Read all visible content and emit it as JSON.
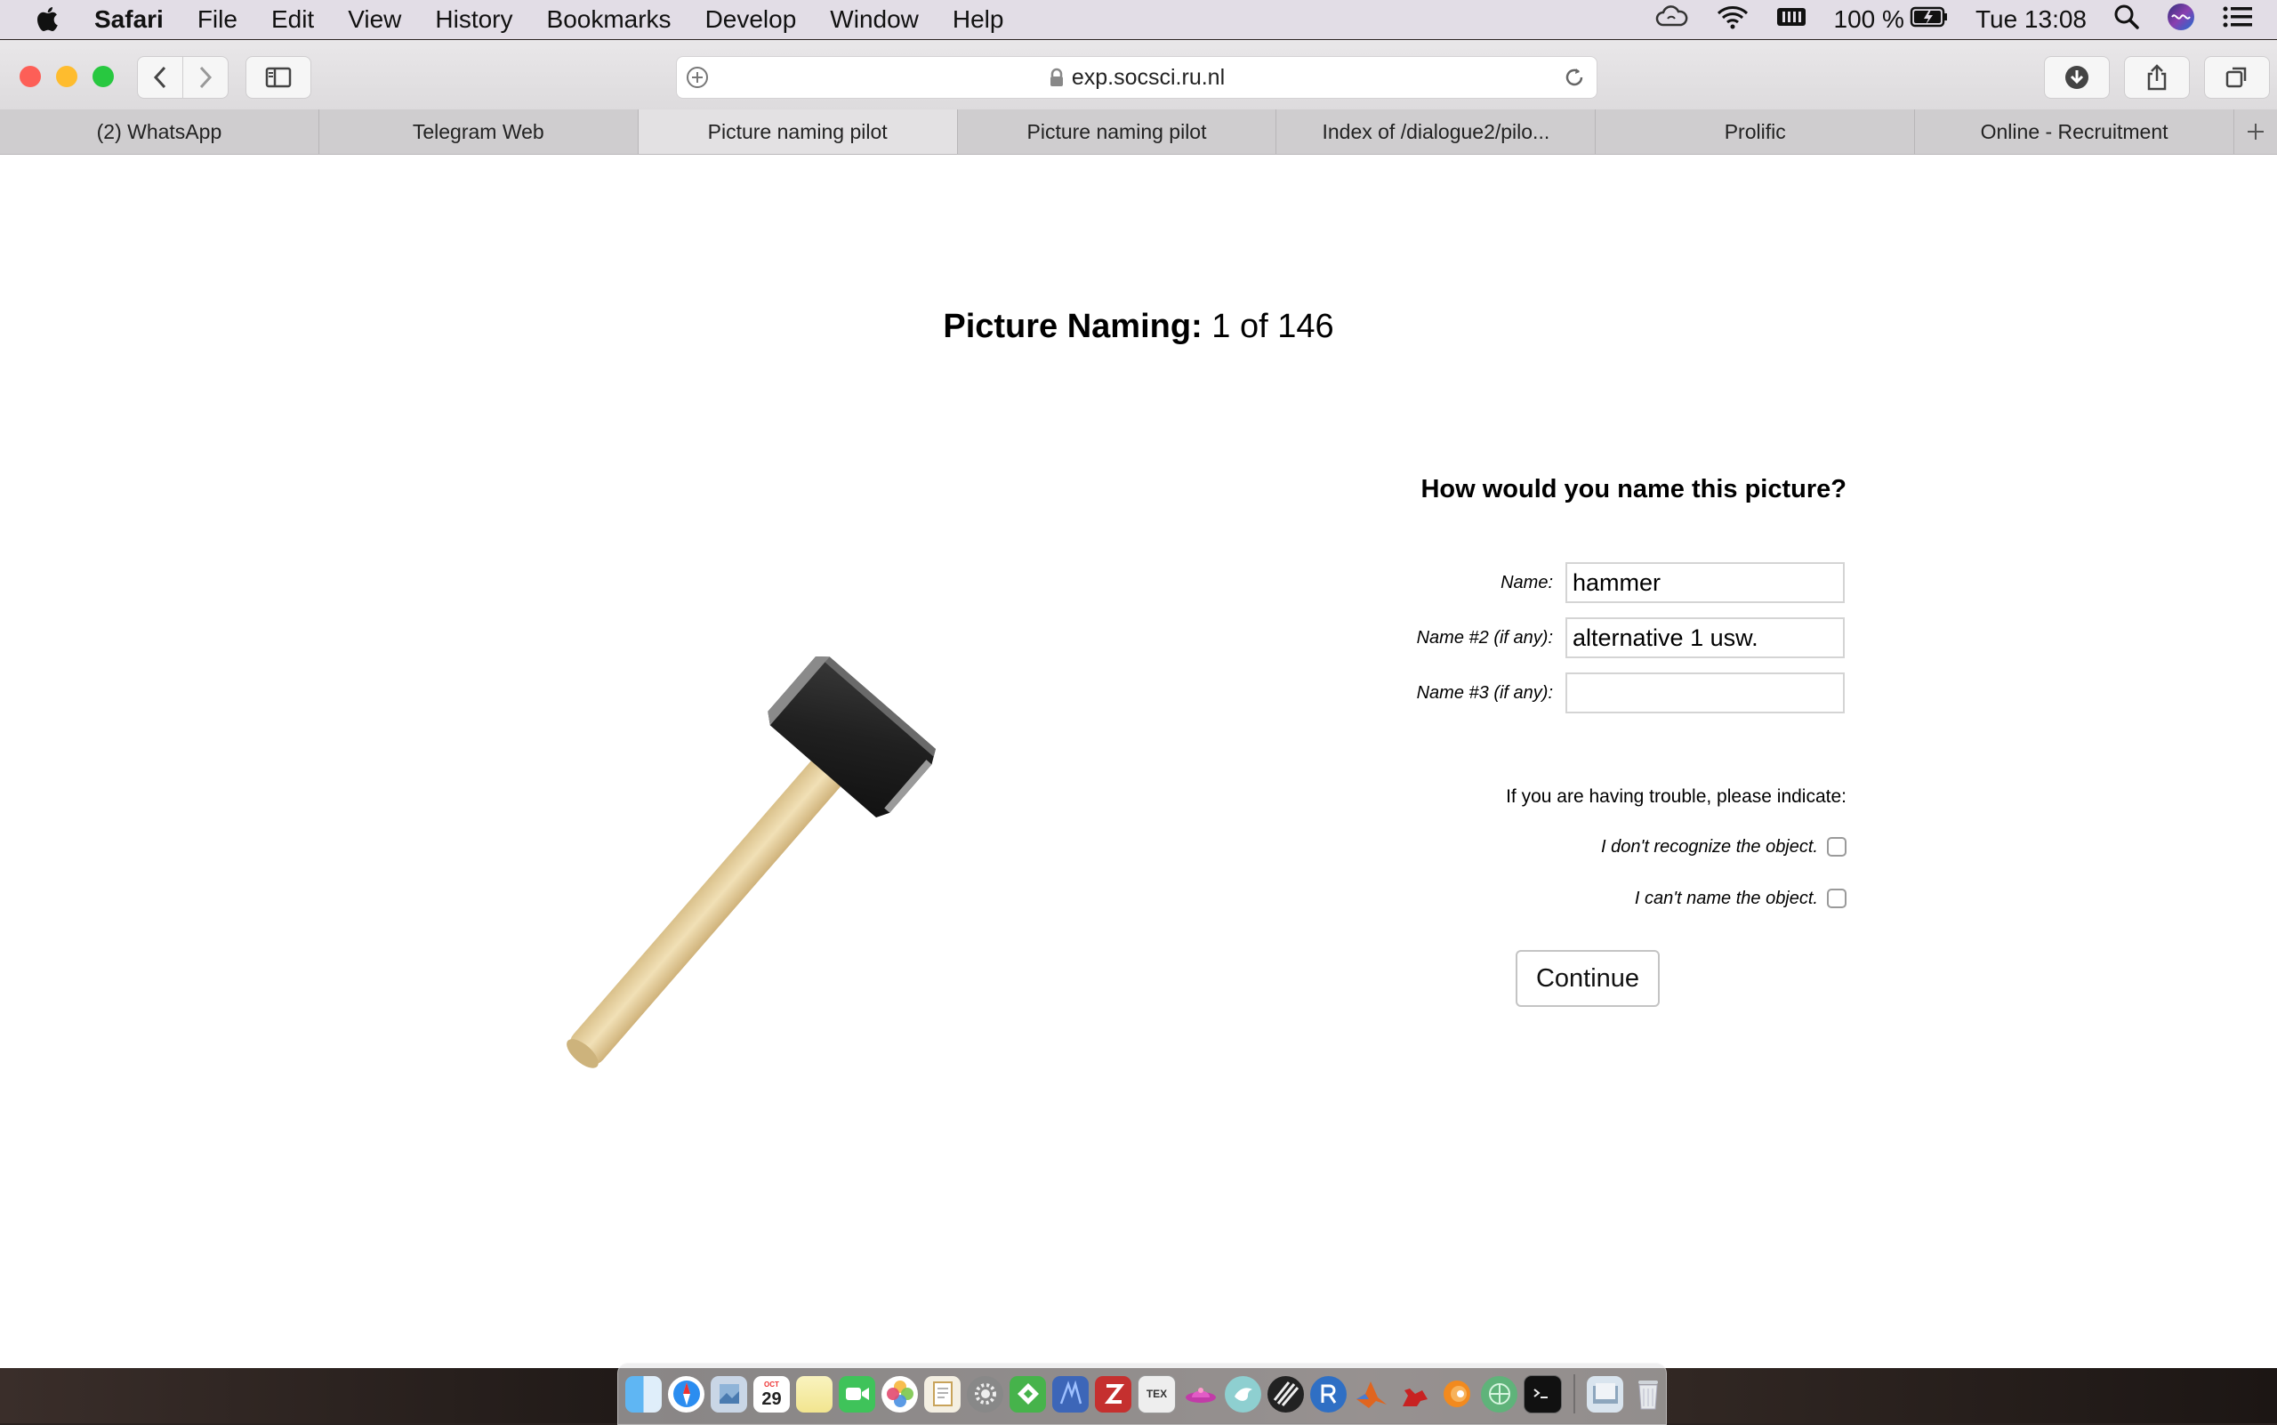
{
  "menubar": {
    "app": "Safari",
    "items": [
      "File",
      "Edit",
      "View",
      "History",
      "Bookmarks",
      "Develop",
      "Window",
      "Help"
    ],
    "battery": "100 %",
    "clock": "Tue 13:08"
  },
  "browser": {
    "url": "exp.socsci.ru.nl",
    "tabs": [
      "(2) WhatsApp",
      "Telegram Web",
      "Picture naming pilot",
      "Picture naming pilot",
      "Index of /dialogue2/pilo...",
      "Prolific",
      "Online - Recruitment"
    ],
    "active_tab_index": 2
  },
  "page": {
    "heading_bold": "Picture Naming:",
    "heading_progress": "1 of 146",
    "question": "How would you name this picture?",
    "name_label": "Name:",
    "name_value": "hammer",
    "name2_label": "Name #2 (if any):",
    "name2_value": "alternative 1 usw.",
    "name3_label": "Name #3 (if any):",
    "name3_value": "",
    "trouble_text": "If you are having trouble, please indicate:",
    "option_unrecognized": "I don't recognize the object.",
    "option_cant_name": "I can't name the object.",
    "continue_label": "Continue",
    "picture": "hammer-image"
  },
  "dock": {
    "calendar_month": "OCT",
    "calendar_day": "29",
    "texshop_label": "TEX"
  },
  "colors": {
    "close": "#fd5f57",
    "minimize": "#febc2e",
    "zoom": "#28c840"
  }
}
